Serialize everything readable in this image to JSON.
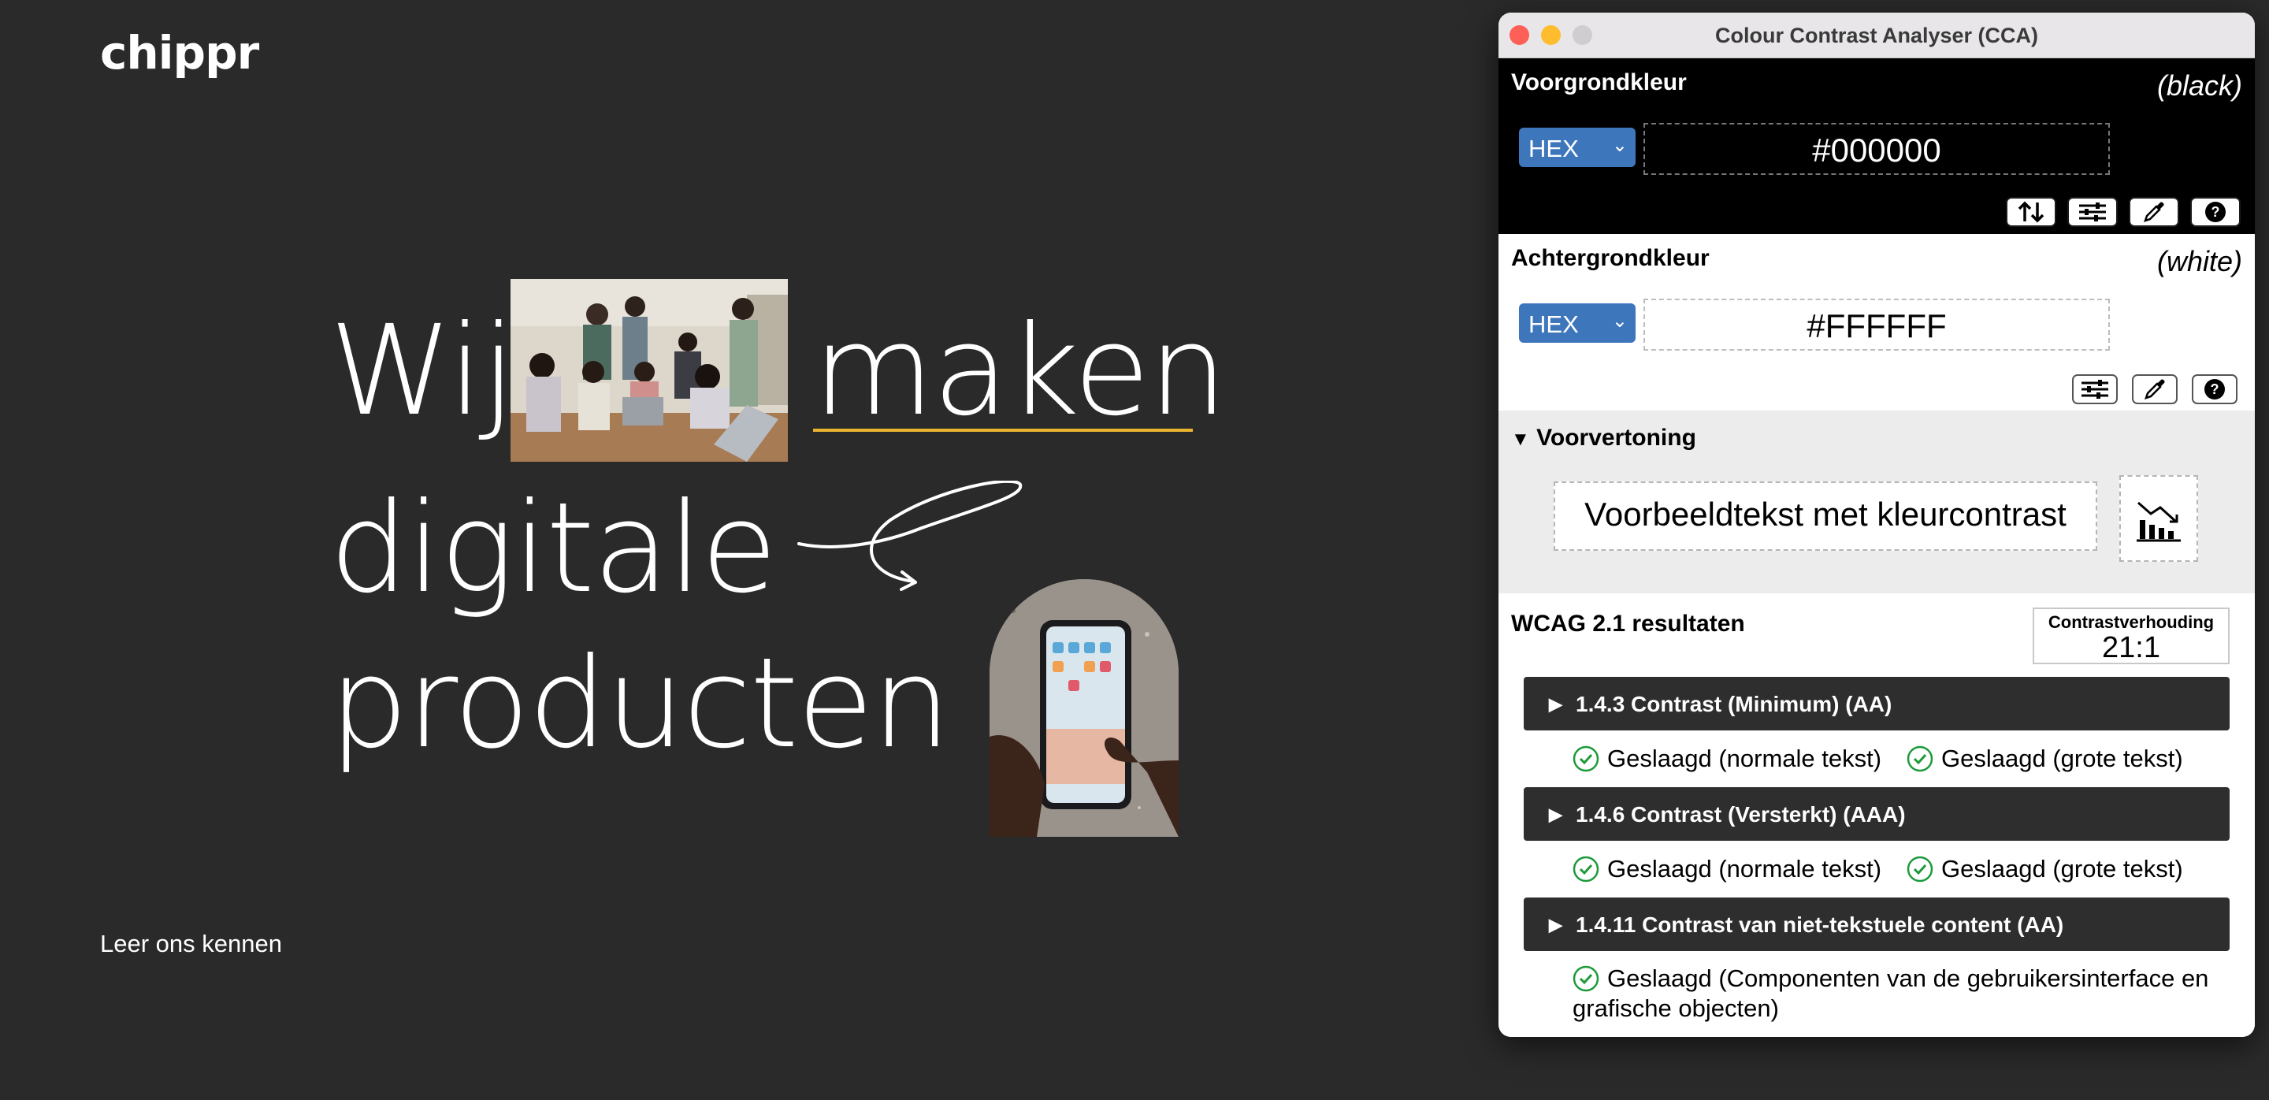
{
  "site": {
    "logo": "chippr",
    "hero": {
      "word1": "Wij",
      "word2": "maken",
      "word3": "digitale",
      "word4": "producten"
    },
    "cta": "Leer ons kennen",
    "colors": {
      "background": "#2a2a2a",
      "accent_underline": "#e9b330"
    }
  },
  "cca": {
    "window_title": "Colour Contrast Analyser (CCA)",
    "foreground": {
      "label": "Voorgrondkleur",
      "color_name": "(black)",
      "format": "HEX",
      "value": "#000000"
    },
    "background": {
      "label": "Achtergrondkleur",
      "color_name": "(white)",
      "format": "HEX",
      "value": "#FFFFFF"
    },
    "preview": {
      "label": "Voorvertoning",
      "sample_text": "Voorbeeldtekst met kleurcontrast"
    },
    "results": {
      "title": "WCAG 2.1 resultaten",
      "ratio_label": "Contrastverhouding",
      "ratio_value": "21:1",
      "criteria": [
        {
          "label": "1.4.3 Contrast (Minimum) (AA)",
          "pass_normal": "Geslaagd (normale tekst)",
          "pass_large": "Geslaagd (grote tekst)"
        },
        {
          "label": "1.4.6 Contrast (Versterkt) (AAA)",
          "pass_normal": "Geslaagd (normale tekst)",
          "pass_large": "Geslaagd (grote tekst)"
        },
        {
          "label": "1.4.11 Contrast van niet-tekstuele content (AA)",
          "pass_text": "Geslaagd (Componenten van de gebruikersinterface en grafische objecten)"
        }
      ]
    },
    "icons": [
      "swap-icon",
      "sliders-icon",
      "eyedropper-icon",
      "help-icon",
      "chart-icon",
      "check-circle-icon",
      "disclosure-triangle-icon"
    ]
  }
}
